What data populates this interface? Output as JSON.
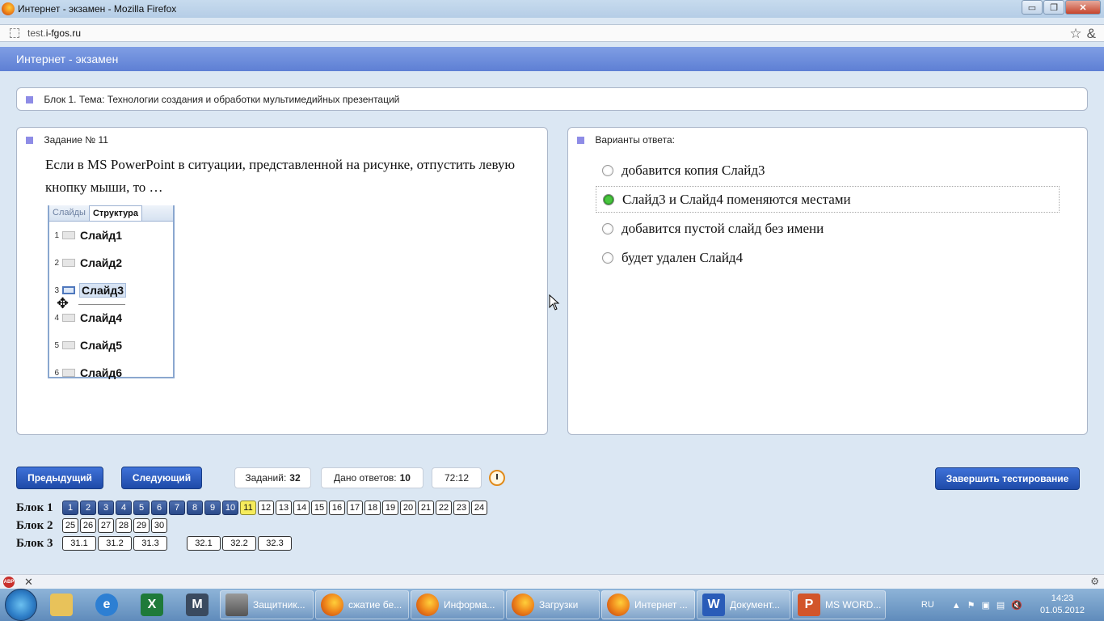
{
  "window": {
    "title": "Интернет - экзамен - Mozilla Firefox",
    "minimize": "▭",
    "maximize": "❐",
    "close": "✕"
  },
  "browser": {
    "url_prefix": "test.",
    "url_domain": "i-fgos.ru",
    "bookmark_icon": "☆",
    "addon_icon": "&"
  },
  "page": {
    "header": "Интернет - экзамен",
    "block_title": "Блок 1. Тема: Технологии создания и обработки мультимедийных презентаций",
    "task": {
      "heading": "Задание № 11",
      "question": "Если в MS PowerPoint в ситуации, представленной на рисунке, отпустить левую кнопку мыши, то …",
      "figure": {
        "tabs": [
          "Слайды",
          "Структура"
        ],
        "slides": [
          {
            "num": "1",
            "label": "Слайд1"
          },
          {
            "num": "2",
            "label": "Слайд2"
          },
          {
            "num": "3",
            "label": "Слайд3"
          },
          {
            "num": "4",
            "label": "Слайд4"
          },
          {
            "num": "5",
            "label": "Слайд5"
          },
          {
            "num": "6",
            "label": "Слайд6"
          }
        ]
      }
    },
    "answers": {
      "heading": "Варианты ответа:",
      "options": [
        {
          "text": "добавится копия Слайд3",
          "selected": false
        },
        {
          "text": "Слайд3 и Слайд4 поменяются местами",
          "selected": true
        },
        {
          "text": "добавится пустой слайд без имени",
          "selected": false
        },
        {
          "text": "будет удален Слайд4",
          "selected": false
        }
      ]
    },
    "controls": {
      "prev": "Предыдущий",
      "next": "Следующий",
      "tasks_label": "Заданий:",
      "tasks_value": "32",
      "answered_label": "Дано ответов:",
      "answered_value": "10",
      "timer": "72:12",
      "finish": "Завершить тестирование"
    },
    "blocks": [
      {
        "label": "Блок 1",
        "items": [
          "1",
          "2",
          "3",
          "4",
          "5",
          "6",
          "7",
          "8",
          "9",
          "10",
          "11",
          "12",
          "13",
          "14",
          "15",
          "16",
          "17",
          "18",
          "19",
          "20",
          "21",
          "22",
          "23",
          "24"
        ]
      },
      {
        "label": "Блок 2",
        "items": [
          "25",
          "26",
          "27",
          "28",
          "29",
          "30"
        ]
      },
      {
        "label": "Блок 3",
        "items": [
          "31.1",
          "31.2",
          "31.3",
          "32.1",
          "32.2",
          "32.3"
        ]
      }
    ],
    "answered_items": [
      "1",
      "2",
      "3",
      "4",
      "5",
      "6",
      "7",
      "8",
      "9",
      "10"
    ],
    "current_item": "11"
  },
  "addon_bar": {
    "abp": "ABP",
    "close": "✕"
  },
  "taskbar": {
    "tasks": [
      {
        "label": "Защитник...",
        "icon": "wall"
      },
      {
        "label": "сжатие бе...",
        "icon": "ff"
      },
      {
        "label": "Информа...",
        "icon": "ff"
      },
      {
        "label": "Загрузки",
        "icon": "ff"
      },
      {
        "label": "Интернет ...",
        "icon": "ff",
        "active": true
      },
      {
        "label": "Документ...",
        "icon": "word"
      },
      {
        "label": "MS WORD...",
        "icon": "ppt"
      }
    ],
    "lang": "RU",
    "time": "14:23",
    "date": "01.05.2012"
  }
}
